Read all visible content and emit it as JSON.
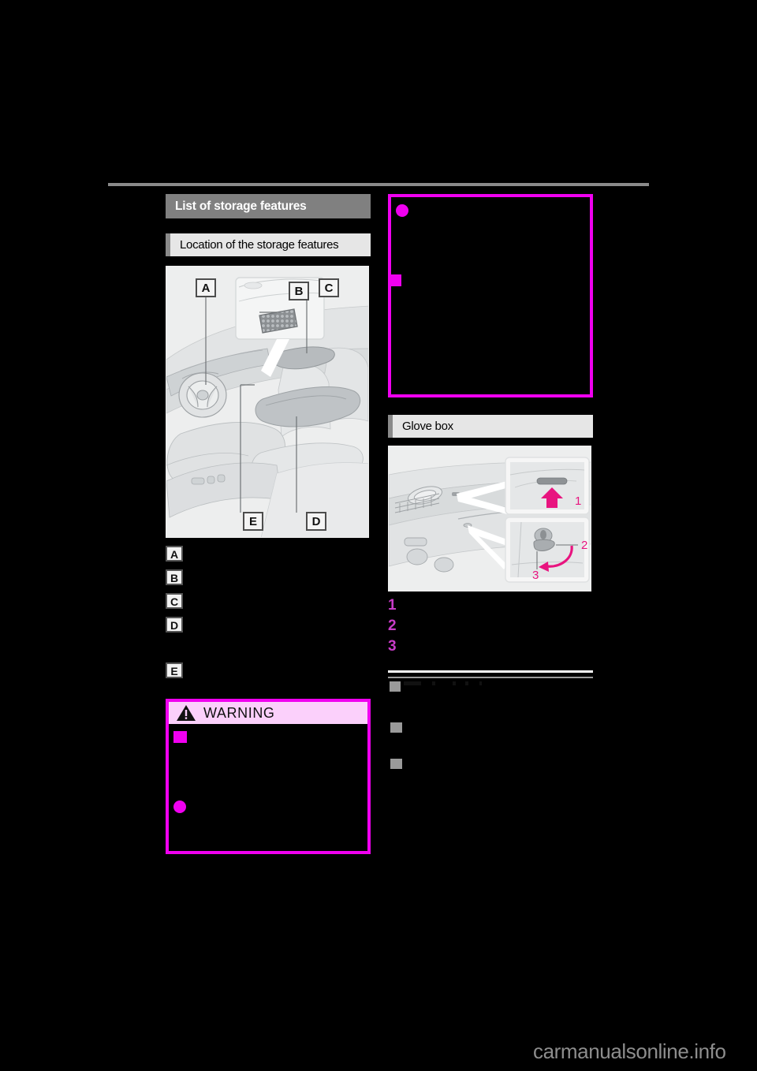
{
  "page": {
    "background_color": "#000000",
    "watermark": "carmanualsonline.info",
    "accent_magenta": "#f000f0",
    "accent_pink_header": "#fbd0fb",
    "heading_gray": "#808080",
    "subheading_gray": "#e6e6e6",
    "rule_gray": "#8a8a8a"
  },
  "left_column": {
    "main_heading": "List of storage features",
    "sub_heading": "Location of the storage features",
    "illustration": {
      "name": "vehicle-interior-storage-locations",
      "callout_labels": [
        "A",
        "B",
        "C",
        "D",
        "E"
      ],
      "inset_label": "B"
    },
    "callout_list": [
      {
        "label": "A",
        "text": ""
      },
      {
        "label": "B",
        "text": ""
      },
      {
        "label": "C",
        "text": ""
      },
      {
        "label": "D",
        "text": ""
      },
      {
        "label": "E",
        "text": ""
      }
    ],
    "warning": {
      "title": "WARNING",
      "icon": "warning-triangle-icon",
      "items": [
        {
          "marker": "square",
          "text": ""
        },
        {
          "marker": "bullet",
          "text": ""
        }
      ]
    }
  },
  "right_column": {
    "warning_continued": {
      "items": [
        {
          "marker": "bullet",
          "text": ""
        },
        {
          "marker": "square",
          "text": ""
        }
      ]
    },
    "glove_box": {
      "heading": "Glove box",
      "illustration": {
        "name": "glove-box-open-and-lock",
        "inset_labels": [
          "1",
          "2",
          "3"
        ]
      },
      "steps": [
        {
          "number": "1",
          "text": ""
        },
        {
          "number": "2",
          "text": ""
        },
        {
          "number": "3",
          "text": ""
        }
      ],
      "sub_section": {
        "heading": "",
        "bullets": [
          {
            "text": ""
          },
          {
            "text": ""
          }
        ]
      }
    }
  }
}
